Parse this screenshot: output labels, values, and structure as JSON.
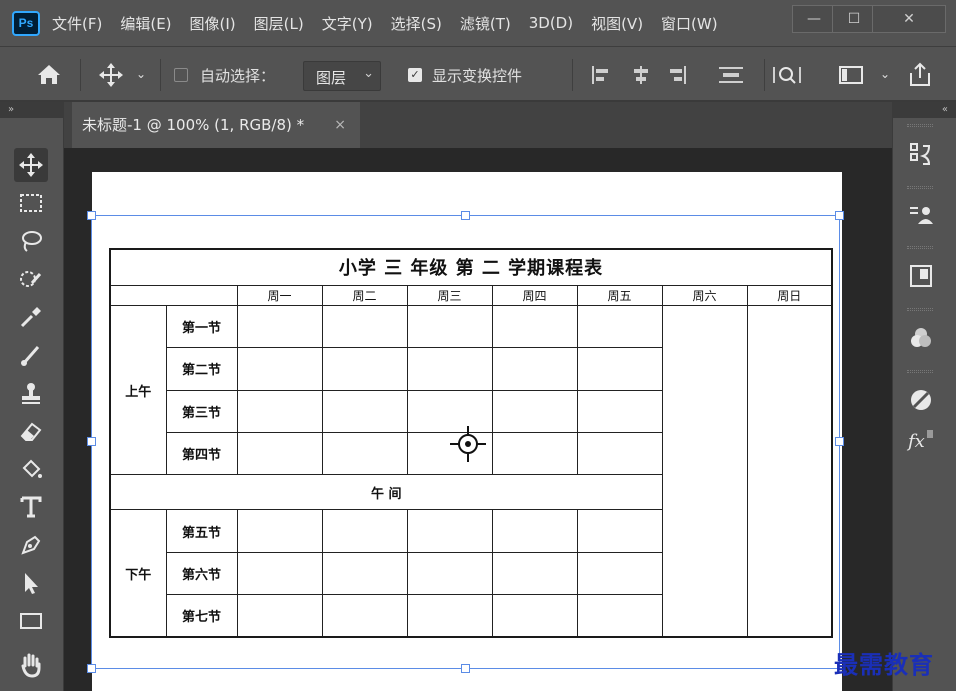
{
  "app": {
    "logo": "Ps"
  },
  "menu": [
    "文件(F)",
    "编辑(E)",
    "图像(I)",
    "图层(L)",
    "文字(Y)",
    "选择(S)",
    "滤镜(T)",
    "3D(D)",
    "视图(V)",
    "窗口(W)"
  ],
  "window_controls": {
    "minimize": "—",
    "maximize": "☐",
    "close": "✕"
  },
  "options": {
    "home_icon": "home-icon",
    "move_icon": "move-icon",
    "auto_select_label": "自动选择：",
    "auto_select_checked": false,
    "layer_dropdown": "图层",
    "show_transform_label": "显示变换控件",
    "show_transform_checked": true
  },
  "panels": {
    "left_collapse": "»",
    "right_collapse": "«"
  },
  "document_tab": {
    "title": "未标题-1 @ 100% (1, RGB/8) *",
    "close": "×"
  },
  "tools": [
    "move-icon",
    "marquee-icon",
    "lasso-icon",
    "quick-select-icon",
    "eyedropper-icon",
    "brush-icon",
    "stamp-icon",
    "eraser-icon",
    "paint-bucket-icon",
    "type-icon",
    "pen-icon",
    "path-select-icon",
    "rectangle-icon",
    "hand-icon"
  ],
  "timetable": {
    "title": "小学 三 年级 第 二 学期课程表",
    "days": [
      "周一",
      "周二",
      "周三",
      "周四",
      "周五",
      "周六",
      "周日"
    ],
    "morning_label": "上午",
    "afternoon_label": "下午",
    "noon_label": "午  间",
    "morning_periods": [
      "第一节",
      "第二节",
      "第三节",
      "第四节"
    ],
    "afternoon_periods": [
      "第五节",
      "第六节",
      "第七节"
    ]
  },
  "right_panel_icons": [
    "history-icon",
    "properties-icon",
    "libraries-icon",
    "channels-icon",
    "adjustments-icon",
    "fx-icon"
  ],
  "watermark": "最需教育",
  "colors": {
    "accent": "#31a8ff",
    "selection": "#5b8ce6",
    "watermark": "#1a2fb8"
  }
}
